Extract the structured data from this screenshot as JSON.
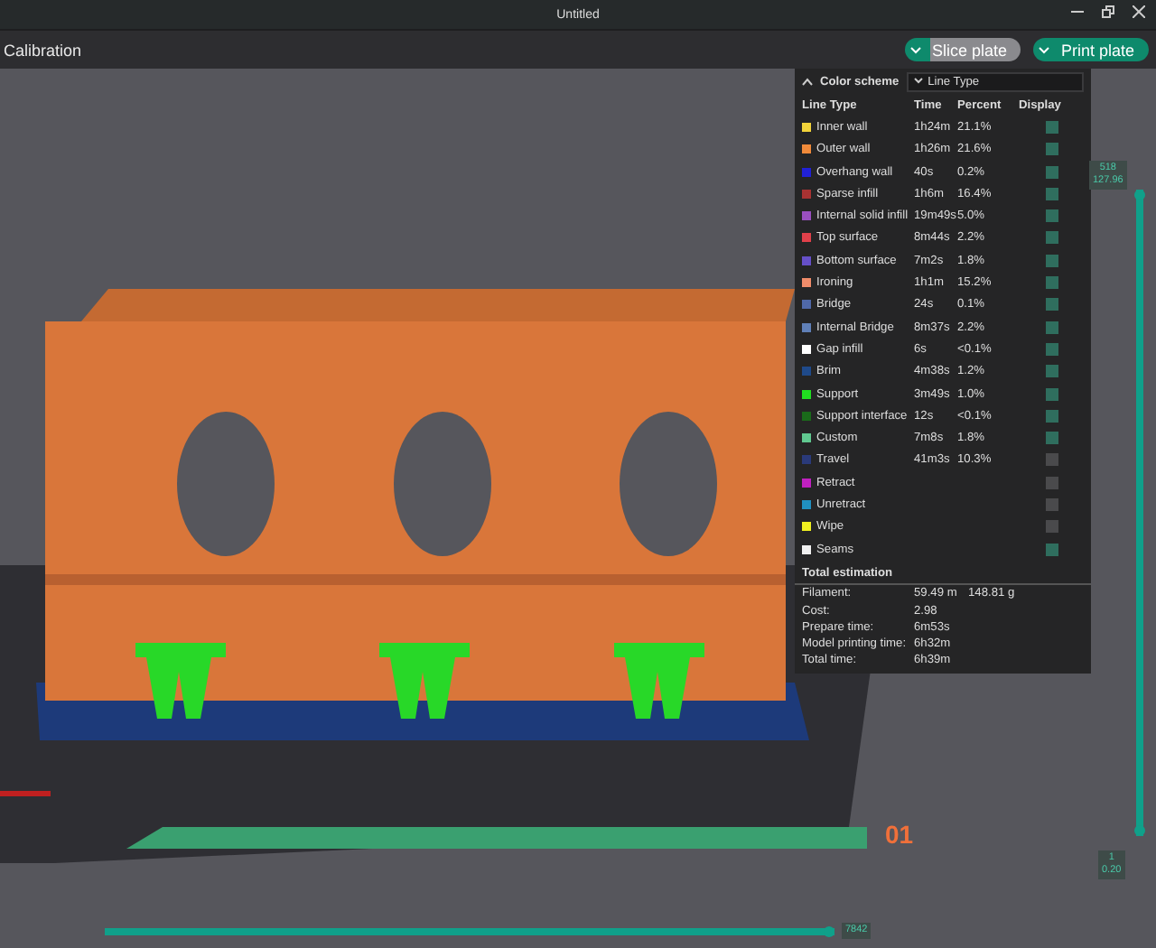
{
  "window": {
    "title": "Untitled"
  },
  "toolbar": {
    "title": "Calibration",
    "buttons": [
      {
        "label": "Slice plate",
        "selected": false
      },
      {
        "label": "Print plate",
        "selected": true
      }
    ]
  },
  "viewport": {
    "plate_number": "01"
  },
  "legend": {
    "header": "Color scheme",
    "scheme": "Line Type",
    "columns": [
      "Line Type",
      "Time",
      "Percent",
      "Display"
    ],
    "rows": [
      {
        "name": "Inner wall",
        "time": "1h24m",
        "percent": "21.1%",
        "color": "#f2d33a",
        "checked": true
      },
      {
        "name": "Outer wall",
        "time": "1h26m",
        "percent": "21.6%",
        "color": "#f08a3a",
        "checked": true
      },
      {
        "name": "Overhang wall",
        "time": "40s",
        "percent": "0.2%",
        "color": "#2121d6",
        "checked": true
      },
      {
        "name": "Sparse infill",
        "time": "1h6m",
        "percent": "16.4%",
        "color": "#a83232",
        "checked": true
      },
      {
        "name": "Internal solid infill",
        "time": "19m49s",
        "percent": "5.0%",
        "color": "#9a4fc0",
        "checked": true
      },
      {
        "name": "Top surface",
        "time": "8m44s",
        "percent": "2.2%",
        "color": "#e0404a",
        "checked": true
      },
      {
        "name": "Bottom surface",
        "time": "7m2s",
        "percent": "1.8%",
        "color": "#6650c8",
        "checked": true
      },
      {
        "name": "Ironing",
        "time": "1h1m",
        "percent": "15.2%",
        "color": "#f08c6a",
        "checked": true
      },
      {
        "name": "Bridge",
        "time": "24s",
        "percent": "0.1%",
        "color": "#5068a8",
        "checked": true
      },
      {
        "name": "Internal Bridge",
        "time": "8m37s",
        "percent": "2.2%",
        "color": "#6080b8",
        "checked": true
      },
      {
        "name": "Gap infill",
        "time": "6s",
        "percent": "<0.1%",
        "color": "#ffffff",
        "checked": true
      },
      {
        "name": "Brim",
        "time": "4m38s",
        "percent": "1.2%",
        "color": "#1f4a8a",
        "checked": true
      },
      {
        "name": "Support",
        "time": "3m49s",
        "percent": "1.0%",
        "color": "#20e020",
        "checked": true
      },
      {
        "name": "Support interface",
        "time": "12s",
        "percent": "<0.1%",
        "color": "#1a6a1a",
        "checked": true
      },
      {
        "name": "Custom",
        "time": "7m8s",
        "percent": "1.8%",
        "color": "#60c890",
        "checked": true
      },
      {
        "name": "Travel",
        "time": "41m3s",
        "percent": "10.3%",
        "color": "#2a3a7a",
        "checked": false
      },
      {
        "name": "Retract",
        "time": "",
        "percent": "",
        "color": "#c020c0",
        "checked": false
      },
      {
        "name": "Unretract",
        "time": "",
        "percent": "",
        "color": "#2090c0",
        "checked": false
      },
      {
        "name": "Wipe",
        "time": "",
        "percent": "",
        "color": "#f0f020",
        "checked": false
      },
      {
        "name": "Seams",
        "time": "",
        "percent": "",
        "color": "#f0f0f0",
        "checked": true
      }
    ],
    "total_title": "Total estimation",
    "totals": [
      {
        "label": "Filament:",
        "values": [
          "59.49 m",
          "148.81 g"
        ]
      },
      {
        "label": "Cost:",
        "values": [
          "2.98"
        ]
      },
      {
        "label": "Prepare time:",
        "values": [
          "6m53s"
        ]
      },
      {
        "label": "Model printing time:",
        "values": [
          "6h32m"
        ]
      },
      {
        "label": "Total time:",
        "values": [
          "6h39m"
        ]
      }
    ]
  },
  "layer_slider": {
    "upper": [
      "518",
      "127.96"
    ],
    "lower": [
      "1",
      "0.20"
    ],
    "level": 1
  },
  "move_slider": {
    "reading": "7842",
    "level": 1
  }
}
